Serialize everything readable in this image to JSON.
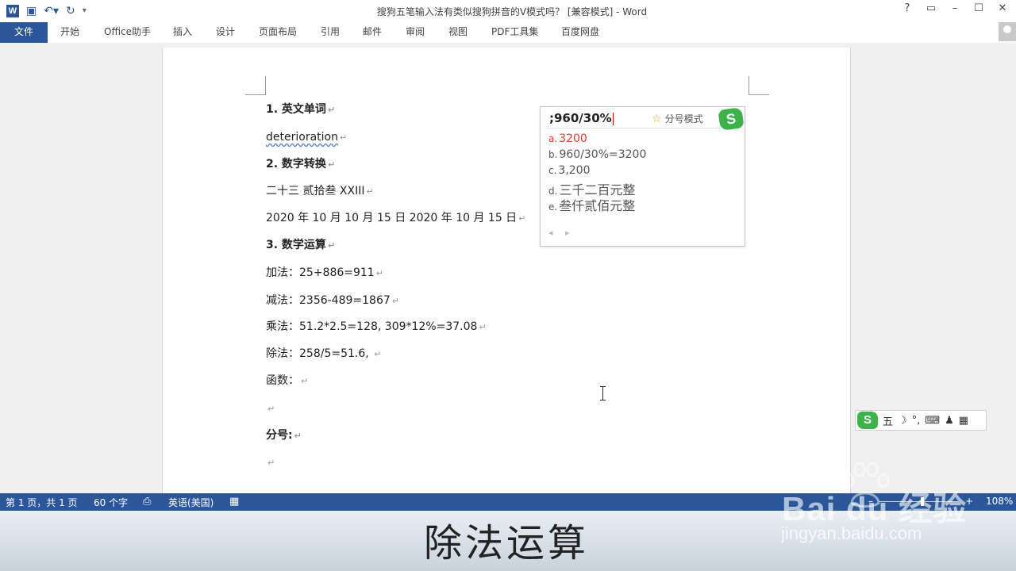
{
  "window": {
    "title": "搜狗五笔输入法有类似搜狗拼音的V模式吗？ [兼容模式] - Word",
    "controls": [
      "?",
      "▭",
      "–",
      "☐",
      "✕"
    ]
  },
  "quick_access": {
    "logo": "W"
  },
  "ribbon": {
    "tabs": [
      "文件",
      "开始",
      "Office助手",
      "插入",
      "设计",
      "页面布局",
      "引用",
      "邮件",
      "审阅",
      "视图",
      "PDF工具集",
      "百度网盘"
    ]
  },
  "document": {
    "lines": [
      {
        "text": "1.   英文单词",
        "bold": true
      },
      {
        "text": "deterioration",
        "bold": false
      },
      {
        "text": "2.   数字转换",
        "bold": true
      },
      {
        "text": "二十三  贰拾叁  XXIII",
        "bold": false
      },
      {
        "text": "2020 年 10 月  10 月 15 日  2020 年 10 月 15 日",
        "bold": false
      },
      {
        "text": "3.   数学运算",
        "bold": true
      },
      {
        "text": "加法：25+886=911",
        "bold": false
      },
      {
        "text": "减法：2356-489=1867",
        "bold": false
      },
      {
        "text": "乘法：51.2*2.5=128, 309*12%=37.08",
        "bold": false
      },
      {
        "text": "除法：258/5=51.6, ",
        "bold": false
      },
      {
        "text": "函数：",
        "bold": false
      },
      {
        "text": "",
        "bold": false
      },
      {
        "text": "分号:",
        "bold": true
      },
      {
        "text": "",
        "bold": false
      }
    ],
    "paragraph_mark": "↵"
  },
  "ime": {
    "input": ";960/30%",
    "mode_label": "分号模式",
    "logo": "S",
    "candidates": [
      {
        "key": "a.",
        "text": "3200"
      },
      {
        "key": "b.",
        "text": "960/30%=3200"
      },
      {
        "key": "c.",
        "text": "3,200"
      },
      {
        "key": "d.",
        "text": "三千二百元整"
      },
      {
        "key": "e.",
        "text": "叁仟贰佰元整"
      }
    ],
    "nav": "◂ ▸"
  },
  "ime_status": {
    "logo": "S",
    "mode": "五",
    "moon": "☽",
    "punct": "°,",
    "keyboard": "⌨",
    "user": "♟",
    "tools": "▦"
  },
  "statusbar": {
    "page": "第 1 页，共 1 页",
    "words": "60 个字",
    "language": "英语(美国)",
    "zoom": "108%",
    "zoom_minus": "–",
    "zoom_plus": "+"
  },
  "caption": "除法运算",
  "watermark": {
    "brand": "Bai du 经验",
    "url": "jingyan.baidu.com"
  },
  "colors": {
    "accent": "#2b579a",
    "ime_green": "#3db24a",
    "candidate_selected": "#e23a2a"
  }
}
